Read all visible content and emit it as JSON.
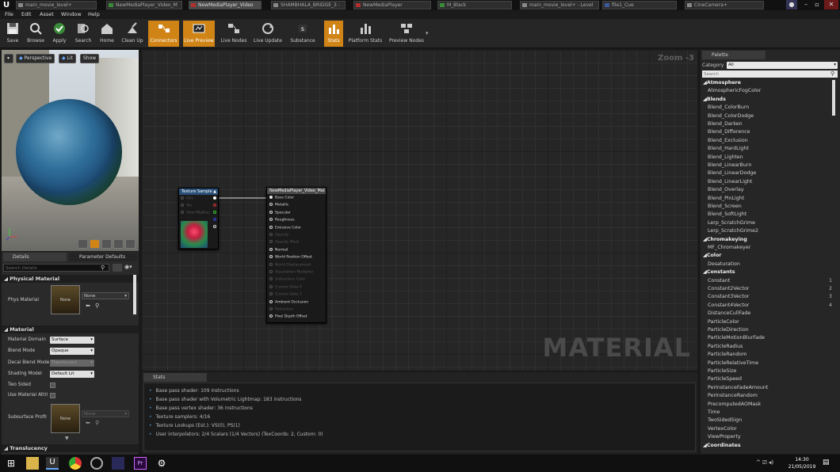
{
  "tabs": [
    {
      "label": "main_movie_level+",
      "active": false
    },
    {
      "label": "NewMediaPlayer_Video_M",
      "active": false
    },
    {
      "label": "NewMediaPlayer_Video",
      "active": false
    },
    {
      "label": "SHAMBHALA_BRIDGE_3 -",
      "active": false
    },
    {
      "label": "NewMediaPlayer",
      "active": false
    },
    {
      "label": "M_Black",
      "active": false
    },
    {
      "label": "main_movie_level+ - Level",
      "active": false
    },
    {
      "label": "file1_Cue",
      "active": false
    },
    {
      "label": "CineCamera+",
      "active": false
    }
  ],
  "menu": [
    "File",
    "Edit",
    "Asset",
    "Window",
    "Help"
  ],
  "toolbar": {
    "save": "Save",
    "browse": "Browse",
    "apply": "Apply",
    "search": "Search",
    "home": "Home",
    "cleanup": "Clean Up",
    "connectors": "Connectors",
    "livepreview": "Live Preview",
    "livenodes": "Live Nodes",
    "liveupdate": "Live Update",
    "substance": "Substance",
    "stats": "Stats",
    "platformstats": "Platform Stats",
    "previewnodes": "Preview Nodes"
  },
  "viewport": {
    "perspective": "Perspective",
    "lit": "Lit",
    "show": "Show"
  },
  "details": {
    "tab_details": "Details",
    "tab_params": "Parameter Defaults",
    "search_placeholder": "Search Details",
    "physmat_section": "Physical Material",
    "physmat_label": "Phys Material",
    "physmat_value": "None",
    "thumb_none": "None",
    "material_section": "Material",
    "domain_label": "Material Domain",
    "domain_value": "Surface",
    "blend_label": "Blend Mode",
    "blend_value": "Opaque",
    "decal_label": "Decal Blend Mode",
    "decal_value": "Translucent",
    "shading_label": "Shading Model",
    "shading_value": "Default Lit",
    "twosided_label": "Two Sided",
    "useattr_label": "Use Material Attri",
    "subsurface_label": "Subsurface Profil",
    "subsurface_value": "None",
    "subsurface_thumb": "None",
    "translucency_section": "Translucency"
  },
  "graph": {
    "zoom": "Zoom -3",
    "watermark": "MATERIAL"
  },
  "texture_node": {
    "title": "Texture Sample",
    "pins_in": [
      "UVs",
      "Tex",
      "View MipBias"
    ]
  },
  "material_node": {
    "title": "NewMediaPlayer_Video_Mat",
    "pins": [
      {
        "label": "Base Color",
        "enabled": true
      },
      {
        "label": "Metallic",
        "enabled": true
      },
      {
        "label": "Specular",
        "enabled": true
      },
      {
        "label": "Roughness",
        "enabled": true
      },
      {
        "label": "Emissive Color",
        "enabled": true
      },
      {
        "label": "Opacity",
        "enabled": false
      },
      {
        "label": "Opacity Mask",
        "enabled": false
      },
      {
        "label": "Normal",
        "enabled": true
      },
      {
        "label": "World Position Offset",
        "enabled": true
      },
      {
        "label": "World Displacement",
        "enabled": false
      },
      {
        "label": "Tessellation Multiplier",
        "enabled": false
      },
      {
        "label": "Subsurface Color",
        "enabled": false
      },
      {
        "label": "Custom Data 0",
        "enabled": false
      },
      {
        "label": "Custom Data 1",
        "enabled": false
      },
      {
        "label": "Ambient Occlusion",
        "enabled": true
      },
      {
        "label": "Refraction",
        "enabled": false
      },
      {
        "label": "Pixel Depth Offset",
        "enabled": true
      }
    ]
  },
  "stats": {
    "tab": "Stats",
    "lines": [
      "Base pass shader: 109 instructions",
      "Base pass shader with Volumetric Lightmap: 183 instructions",
      "Base pass vertex shader: 36 instructions",
      "Texture samplers: 4/16",
      "Texture Lookups (Est.): VS(0), PS(1)",
      "User interpolators: 2/4 Scalars (1/4 Vectors) (TexCoords: 2, Custom: 0)"
    ]
  },
  "palette": {
    "tab": "Palette",
    "category_label": "Category",
    "category_value": "All",
    "search_placeholder": "Search",
    "rows": [
      {
        "t": "cat",
        "label": "Atmosphere"
      },
      {
        "t": "item",
        "label": "AtmosphericFogColor"
      },
      {
        "t": "cat",
        "label": "Blends"
      },
      {
        "t": "item",
        "label": "Blend_ColorBurn"
      },
      {
        "t": "item",
        "label": "Blend_ColorDodge"
      },
      {
        "t": "item",
        "label": "Blend_Darken"
      },
      {
        "t": "item",
        "label": "Blend_Difference"
      },
      {
        "t": "item",
        "label": "Blend_Exclusion"
      },
      {
        "t": "item",
        "label": "Blend_HardLight"
      },
      {
        "t": "item",
        "label": "Blend_Lighten"
      },
      {
        "t": "item",
        "label": "Blend_LinearBurn"
      },
      {
        "t": "item",
        "label": "Blend_LinearDodge"
      },
      {
        "t": "item",
        "label": "Blend_LinearLight"
      },
      {
        "t": "item",
        "label": "Blend_Overlay"
      },
      {
        "t": "item",
        "label": "Blend_PinLight"
      },
      {
        "t": "item",
        "label": "Blend_Screen"
      },
      {
        "t": "item",
        "label": "Blend_SoftLight"
      },
      {
        "t": "item",
        "label": "Lerp_ScratchGrime"
      },
      {
        "t": "item",
        "label": "Lerp_ScratchGrime2"
      },
      {
        "t": "cat",
        "label": "Chromakeying"
      },
      {
        "t": "item",
        "label": "MF_Chromakeyer"
      },
      {
        "t": "cat",
        "label": "Color"
      },
      {
        "t": "item",
        "label": "Desaturation"
      },
      {
        "t": "cat",
        "label": "Constants"
      },
      {
        "t": "item",
        "label": "Constant",
        "key": "1"
      },
      {
        "t": "item",
        "label": "Constant2Vector",
        "key": "2"
      },
      {
        "t": "item",
        "label": "Constant3Vector",
        "key": "3"
      },
      {
        "t": "item",
        "label": "Constant4Vector",
        "key": "4"
      },
      {
        "t": "item",
        "label": "DistanceCullFade"
      },
      {
        "t": "item",
        "label": "ParticleColor"
      },
      {
        "t": "item",
        "label": "ParticleDirection"
      },
      {
        "t": "item",
        "label": "ParticleMotionBlurFade"
      },
      {
        "t": "item",
        "label": "ParticleRadius"
      },
      {
        "t": "item",
        "label": "ParticleRandom"
      },
      {
        "t": "item",
        "label": "ParticleRelativeTime"
      },
      {
        "t": "item",
        "label": "ParticleSize"
      },
      {
        "t": "item",
        "label": "ParticleSpeed"
      },
      {
        "t": "item",
        "label": "PerInstanceFadeAmount"
      },
      {
        "t": "item",
        "label": "PerInstanceRandom"
      },
      {
        "t": "item",
        "label": "PrecomputedAOMask"
      },
      {
        "t": "item",
        "label": "Time"
      },
      {
        "t": "item",
        "label": "TwoSidedSign"
      },
      {
        "t": "item",
        "label": "VertexColor"
      },
      {
        "t": "item",
        "label": "ViewProperty"
      },
      {
        "t": "cat",
        "label": "Coordinates"
      }
    ]
  },
  "taskbar": {
    "time": "14:30",
    "date": "21/05/2019"
  },
  "colors": {
    "accent": "#d08416",
    "node_header": "#2a5078",
    "link": "#4a90d0"
  }
}
